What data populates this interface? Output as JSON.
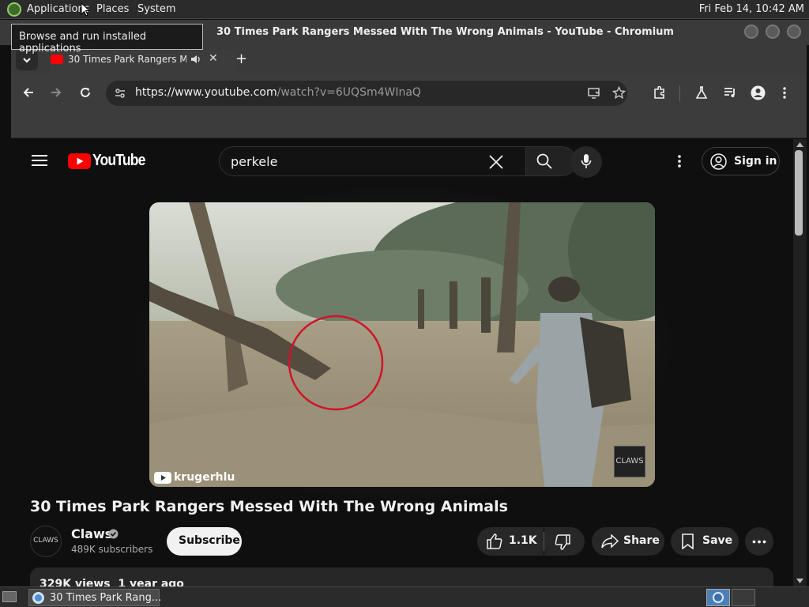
{
  "top_panel": {
    "menus": [
      "Applications",
      "Places",
      "System"
    ],
    "clock": "Fri Feb 14, 10:42 AM"
  },
  "tooltip": "Browse and run installed applications",
  "window": {
    "title": "30 Times Park Rangers Messed With The Wrong Animals - YouTube - Chromium"
  },
  "browser": {
    "tab_title": "30 Times Park Rangers M",
    "url_host": "https://www.youtube.com",
    "url_path": "/watch?v=6UQSm4WInaQ"
  },
  "youtube": {
    "logo_text": "YouTube",
    "search_value": "perkele",
    "signin_label": "Sign in",
    "video": {
      "watermark": "krugerhlu",
      "corner_logo": "CLAWS"
    },
    "video_title": "30 Times Park Rangers Messed With The Wrong Animals",
    "channel": {
      "name": "Claws",
      "subscribers": "489K subscribers",
      "avatar_text": "CLAWS"
    },
    "subscribe_label": "Subscribe",
    "likes": "1.1K",
    "share_label": "Share",
    "save_label": "Save",
    "description_meta": "329K views  1 year ago"
  },
  "taskbar": {
    "item_label": "30 Times Park Rang..."
  },
  "colors": {
    "yt_red": "#ff0000",
    "circle_red": "#d0132b"
  }
}
